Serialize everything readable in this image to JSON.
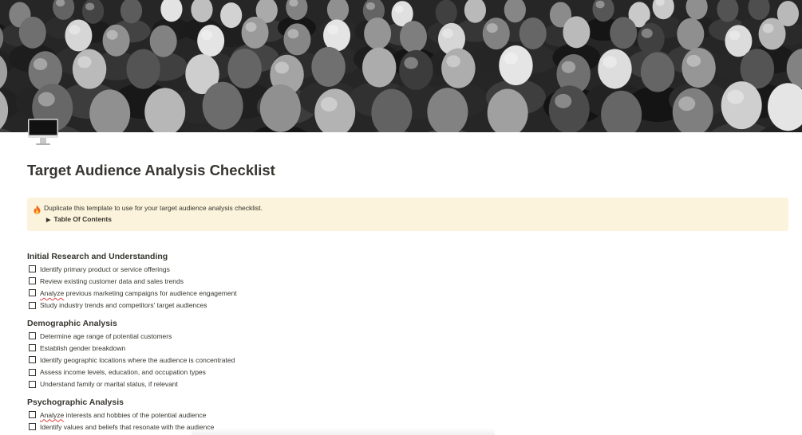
{
  "cover": {
    "icon": "crowd-photo"
  },
  "page": {
    "icon": "computer-monitor-icon",
    "title": "Target Audience Analysis Checklist"
  },
  "callout": {
    "emoji": "fire-icon",
    "text": "Duplicate this template to use for your target audience analysis checklist.",
    "toggle_label": "Table Of Contents"
  },
  "sections": [
    {
      "heading": "Initial Research and Understanding",
      "items": [
        {
          "prefix": "",
          "spell": "",
          "text": "Identify primary product or service offerings",
          "checked": false
        },
        {
          "prefix": "",
          "spell": "",
          "text": "Review existing customer data and sales trends",
          "checked": false
        },
        {
          "prefix": "",
          "spell": "Analyze",
          "text": " previous marketing campaigns for audience engagement",
          "checked": false
        },
        {
          "prefix": "",
          "spell": "",
          "text": "Study industry trends and competitors' target audiences",
          "checked": false
        }
      ]
    },
    {
      "heading": "Demographic Analysis",
      "items": [
        {
          "prefix": "",
          "spell": "",
          "text": "Determine age range of potential customers",
          "checked": false
        },
        {
          "prefix": "",
          "spell": "",
          "text": "Establish gender breakdown",
          "checked": false
        },
        {
          "prefix": "",
          "spell": "",
          "text": "Identify geographic locations where the audience is concentrated",
          "checked": false
        },
        {
          "prefix": "",
          "spell": "",
          "text": "Assess income levels, education, and occupation types",
          "checked": false
        },
        {
          "prefix": "",
          "spell": "",
          "text": "Understand family or marital status, if relevant",
          "checked": false
        }
      ]
    },
    {
      "heading": "Psychographic Analysis",
      "items": [
        {
          "prefix": "",
          "spell": "Analyze",
          "text": " interests and hobbies of the potential audience",
          "checked": false
        },
        {
          "prefix": "",
          "spell": "",
          "text": "Identify values and beliefs that resonate with the audience",
          "checked": false
        }
      ]
    }
  ]
}
